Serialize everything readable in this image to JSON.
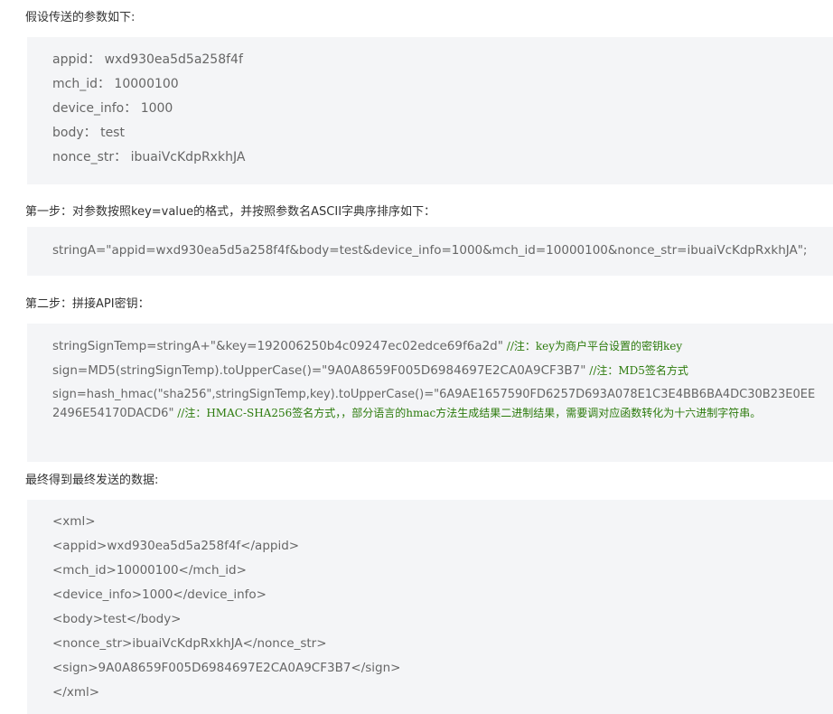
{
  "intro": {
    "heading": "假设传送的参数如下:",
    "params": [
      "appid： wxd930ea5d5a258f4f",
      "mch_id： 10000100",
      "device_info： 1000",
      "body： test",
      "nonce_str： ibuaiVcKdpRxkhJA"
    ]
  },
  "step1": {
    "heading": "第一步：对参数按照key=value的格式，并按照参数名ASCII字典序排序如下：",
    "code": "stringA=\"appid=wxd930ea5d5a258f4f&body=test&device_info=1000&mch_id=10000100&nonce_str=ibuaiVcKdpRxkhJA\";"
  },
  "step2": {
    "heading": "第二步：拼接API密钥：",
    "lines": [
      {
        "code": "stringSignTemp=stringA+\"&key=192006250b4c09247ec02edce69f6a2d\"",
        "comment": " //注：key为商户平台设置的密钥key"
      },
      {
        "code": "sign=MD5(stringSignTemp).toUpperCase()=\"9A0A8659F005D6984697E2CA0A9CF3B7\"",
        "comment": " //注：MD5签名方式"
      },
      {
        "code": "sign=hash_hmac(\"sha256\",stringSignTemp,key).toUpperCase()=\"6A9AE1657590FD6257D693A078E1C3E4BB6BA4DC30B23E0EE2496E54170DACD6\"",
        "comment": " //注：HMAC-SHA256签名方式，，部分语言的hmac方法生成结果二进制结果，需要调对应函数转化为十六进制字符串。"
      }
    ]
  },
  "final": {
    "heading": "最终得到最终发送的数据:",
    "xml": [
      "<xml>",
      "<appid>wxd930ea5d5a258f4f</appid>",
      "<mch_id>10000100</mch_id>",
      "<device_info>1000</device_info>",
      "<body>test</body>",
      "<nonce_str>ibuaiVcKdpRxkhJA</nonce_str>",
      "<sign>9A0A8659F005D6984697E2CA0A9CF3B7</sign>",
      "</xml>"
    ]
  }
}
